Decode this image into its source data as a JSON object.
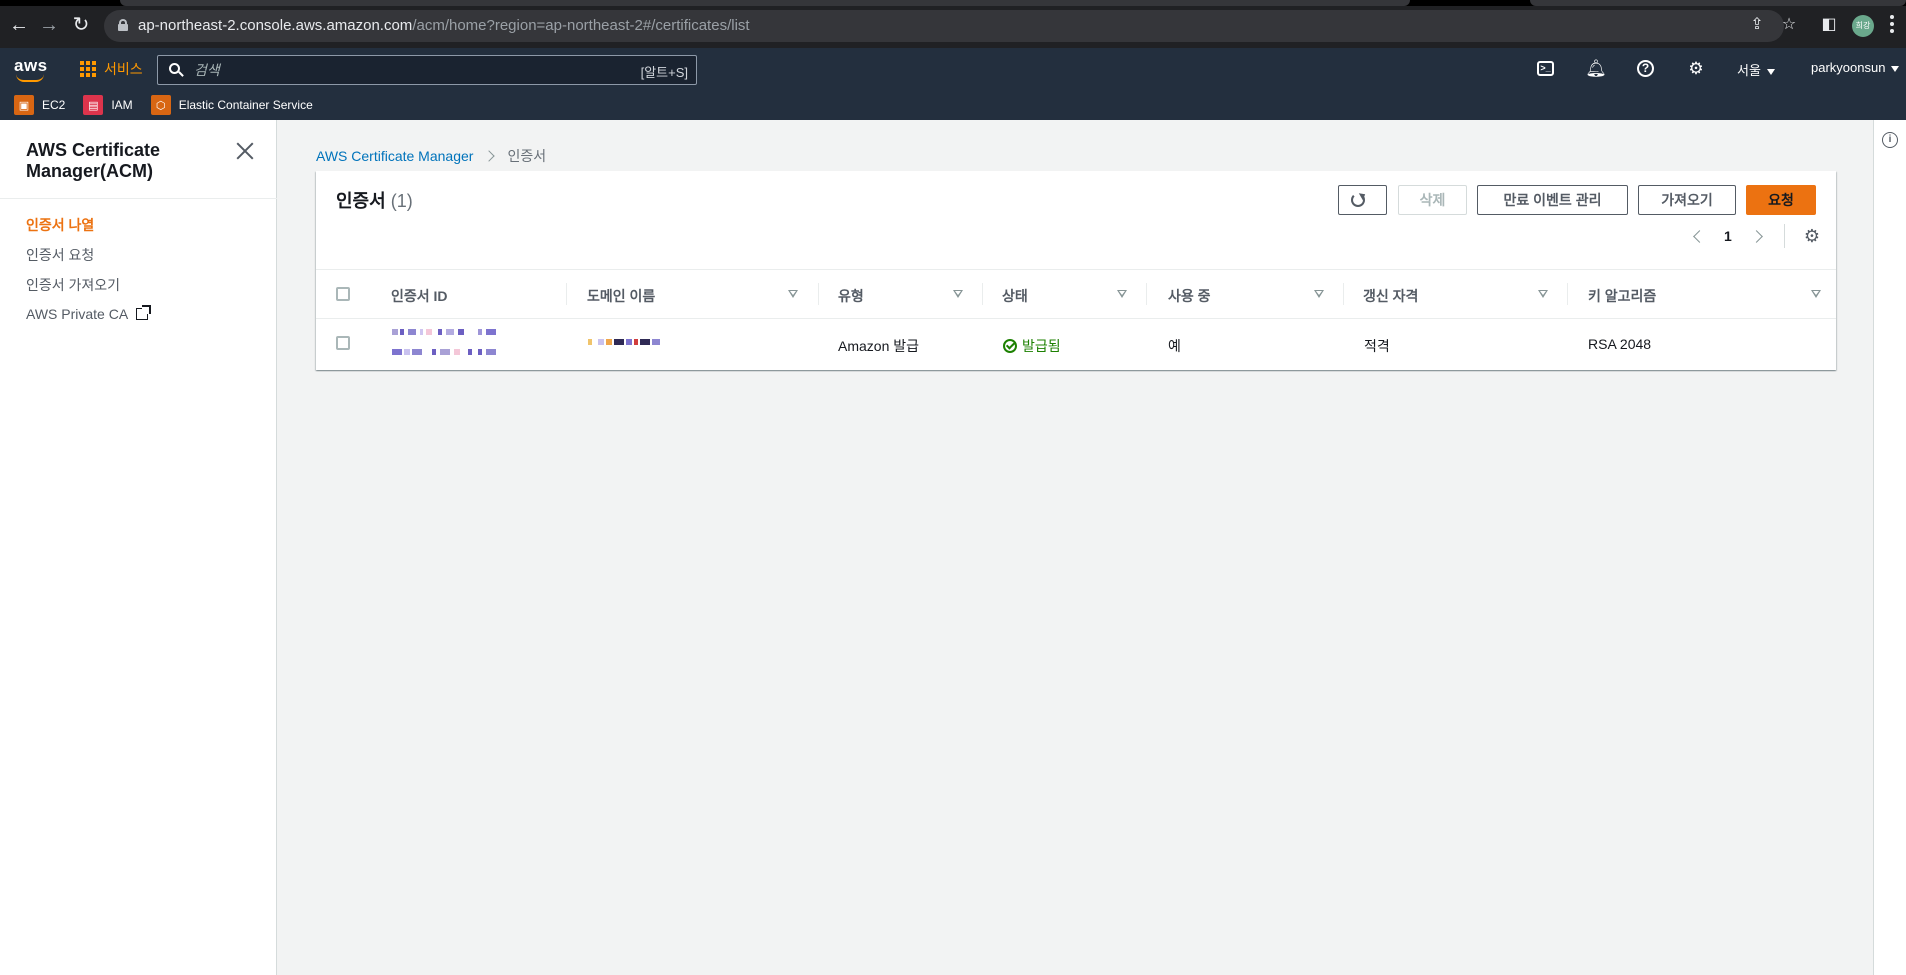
{
  "browser": {
    "url_host": "ap-northeast-2.console.aws.amazon.com",
    "url_path": "/acm/home?region=ap-northeast-2#/certificates/list",
    "profile_initials": "희강"
  },
  "aws_header": {
    "logo_text": "aws",
    "services_label": "서비스",
    "search_placeholder": "검색",
    "search_shortcut": "[알트+S]",
    "region_label": "서울",
    "user_label": "parkyoonsun",
    "favorites": [
      {
        "label": "EC2",
        "icon": "ec2-icon"
      },
      {
        "label": "IAM",
        "icon": "iam-icon"
      },
      {
        "label": "Elastic Container Service",
        "icon": "ecs-icon"
      }
    ]
  },
  "sidenav": {
    "title": "AWS Certificate Manager(ACM)",
    "items": [
      {
        "label": "인증서 나열",
        "active": true
      },
      {
        "label": "인증서 요청",
        "active": false
      },
      {
        "label": "인증서 가져오기",
        "active": false
      },
      {
        "label": "AWS Private CA",
        "active": false,
        "external": true
      }
    ]
  },
  "breadcrumb": {
    "root": "AWS Certificate Manager",
    "current": "인증서"
  },
  "panel": {
    "title": "인증서",
    "count": "(1)",
    "buttons": {
      "delete": "삭제",
      "manage_expiry": "만료 이벤트 관리",
      "import": "가져오기",
      "request": "요청"
    },
    "page_number": "1"
  },
  "table": {
    "columns": [
      "인증서 ID",
      "도메인 이름",
      "유형",
      "상태",
      "사용 중",
      "갱신 자격",
      "키 알고리즘"
    ],
    "rows": [
      {
        "certificate_id": "",
        "domain_name": "",
        "type": "Amazon 발급",
        "status": "발급됨",
        "in_use": "예",
        "renewal_eligibility": "적격",
        "key_algorithm": "RSA 2048"
      }
    ]
  },
  "colors": {
    "aws_orange": "#ec7211",
    "header_bg": "#232f3e",
    "link_blue": "#0073bb",
    "success_green": "#1d8102"
  }
}
